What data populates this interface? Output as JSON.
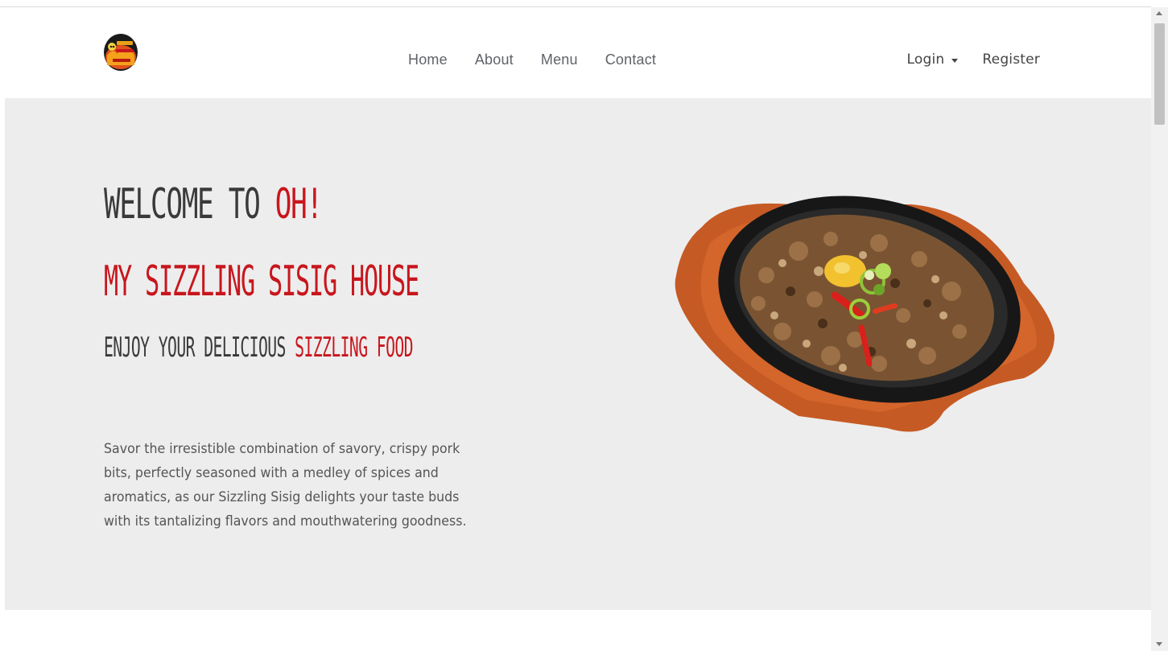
{
  "nav": {
    "links": [
      "Home",
      "About",
      "Menu",
      "Contact"
    ],
    "login_label": "Login",
    "register_label": "Register"
  },
  "hero": {
    "line1_prefix": "Welcome to ",
    "line1_accent": "Oh!",
    "line2": "My Sizzling Sisig House",
    "line3_prefix": "Enjoy Your Delicious ",
    "line3_accent": "Sizzling Food",
    "description": "Savor the irresistible combination of savory, crispy pork bits, perfectly seasoned with a medley of spices and aromatics, as our Sizzling Sisig delights your taste buds with its tantalizing flavors and mouthwatering goodness."
  },
  "colors": {
    "accent": "#c8161d",
    "hero_bg": "#ededed",
    "text": "#3a3a3a"
  }
}
